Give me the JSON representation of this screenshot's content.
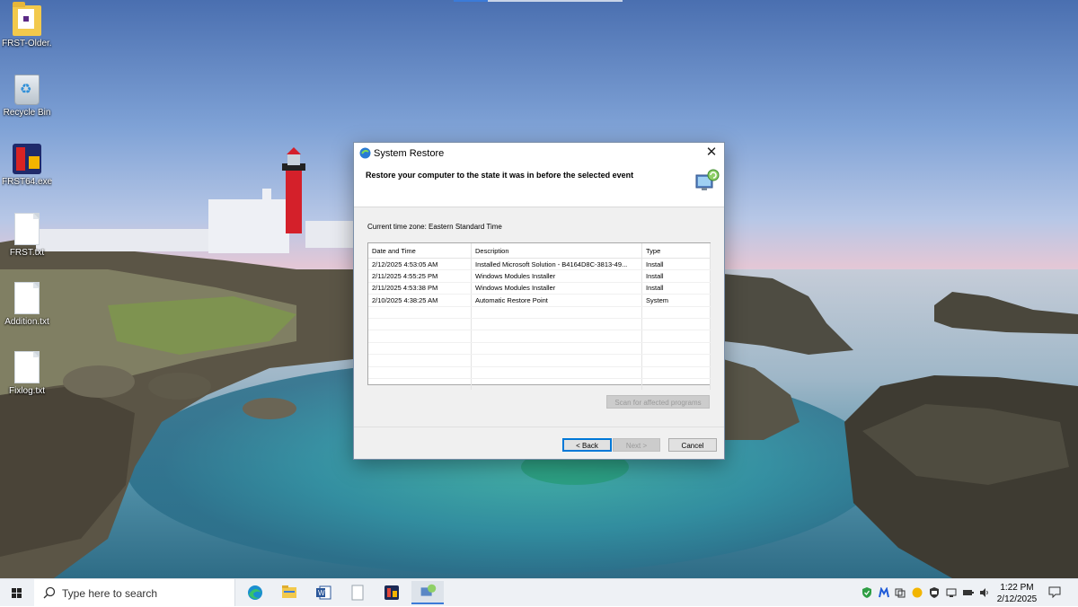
{
  "desktop": {
    "icons": [
      {
        "label": "FRST-Older..."
      },
      {
        "label": "Recycle Bin"
      },
      {
        "label": "FRST64.exe"
      },
      {
        "label": "FRST.txt"
      },
      {
        "label": "Addition.txt"
      },
      {
        "label": "Fixlog.txt"
      }
    ]
  },
  "dialog": {
    "title": "System Restore",
    "close_glyph": "✕",
    "heading": "Restore your computer to the state it was in before the selected event",
    "timezone": "Current time zone: Eastern Standard Time",
    "columns": [
      "Date and Time",
      "Description",
      "Type"
    ],
    "sort_glyph": "ˇ",
    "rows": [
      {
        "date": "2/12/2025 4:53:05 AM",
        "description": "Installed Microsoft Solution - B4164D8C-3813-49...",
        "type": "Install"
      },
      {
        "date": "2/11/2025 4:55:25 PM",
        "description": "Windows Modules Installer",
        "type": "Install"
      },
      {
        "date": "2/11/2025 4:53:38 PM",
        "description": "Windows Modules Installer",
        "type": "Install"
      },
      {
        "date": "2/10/2025 4:38:25 AM",
        "description": "Automatic Restore Point",
        "type": "System"
      }
    ],
    "scan_button": "Scan for affected programs",
    "back_button": "< Back",
    "next_button": "Next >",
    "cancel_button": "Cancel"
  },
  "taskbar": {
    "search_placeholder": "Type here to search",
    "apps": [
      "edge-icon",
      "file-explorer-icon",
      "word-icon",
      "notepad-icon",
      "frst-icon",
      "system-restore-icon"
    ],
    "time": "1:22 PM",
    "date": "2/12/2025"
  },
  "colors": {
    "accent": "#0078d7",
    "dialog_bg": "#f0f0f0",
    "taskbar_bg": "#eef1f5"
  }
}
